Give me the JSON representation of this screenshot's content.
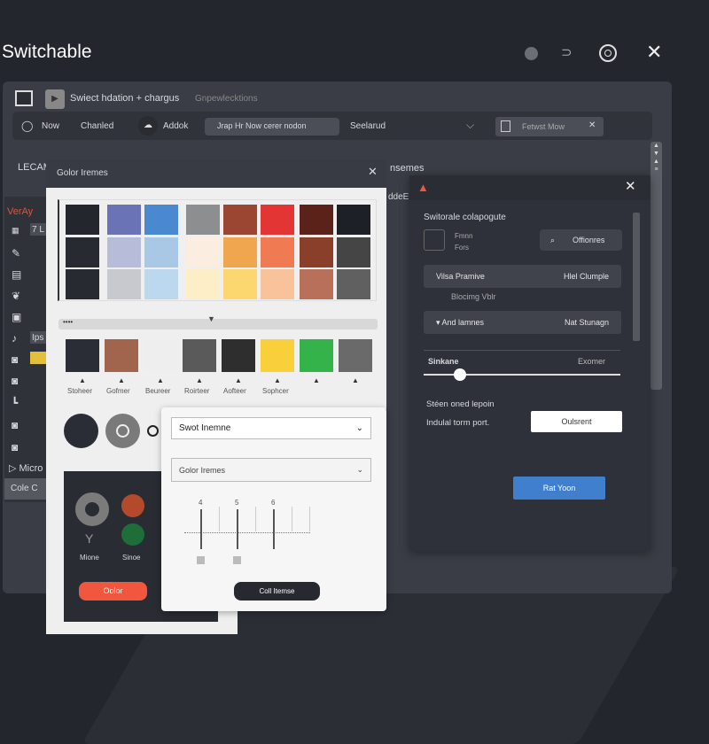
{
  "app": {
    "title": "Switchable"
  },
  "window": {
    "title": "Swiect hdation + chargus",
    "subtitle": "Gnpewlecktions"
  },
  "toolbar": {
    "items": [
      "Now",
      "Chanled",
      "Addok"
    ],
    "search_value": "Jrap  Hr  Now cerer nodon",
    "dropdown": "Seelarud",
    "tab_label": "Fetwst  Mow"
  },
  "second_row": {
    "left": "LECAM",
    "right1": "nsemes",
    "right2": "ddeE"
  },
  "sidebar": {
    "heading": "VerAy",
    "field1": "7 L",
    "field2": "Ips",
    "bottom_item": "Micro",
    "bottom_tab1": "Cole",
    "bottom_tab2": "C"
  },
  "color_dialog": {
    "title": "Golor Iremes",
    "grid": [
      [
        "#24262d",
        "#6a73b6",
        "#4a88cf",
        "#8d8e90",
        "#9a4632",
        "#e23534",
        "#5a2218",
        "#1e2027"
      ],
      [
        "#272a31",
        "#b7bcd8",
        "#a9c8e6",
        "#fbeee0",
        "#f0a54f",
        "#f07a52",
        "#8a3f2a",
        "#454545"
      ],
      [
        "#272a31",
        "#c7c9ce",
        "#bcd8ee",
        "#fcefc8",
        "#fcd770",
        "#f8c29b",
        "#b9705a",
        "#606060"
      ]
    ],
    "swatches": [
      {
        "color": "#2a2d35",
        "label": "Stoheer"
      },
      {
        "color": "#a0654c",
        "label": "Gofmer"
      },
      {
        "color": "#eeeeee",
        "label": "Beureer"
      },
      {
        "color": "#5a5a5a",
        "label": "Roirteer"
      },
      {
        "color": "#2e2e2e",
        "label": "Aofteer"
      },
      {
        "color": "#f9cf3c",
        "label": "Sophcer"
      },
      {
        "color": "#33b34a",
        "label": ""
      },
      {
        "color": "#6a6a6a",
        "label": ""
      }
    ],
    "card": {
      "label1": "Mione",
      "label2": "Sinoe",
      "button": "Oolor"
    }
  },
  "theme_card": {
    "select1": "Swot Inemne",
    "select2": "Golor Iremes",
    "ticks": [
      "4",
      "5",
      "6"
    ],
    "button": "Coll Itemse"
  },
  "right_panel": {
    "title": "Switorale colapogute",
    "check_line1": "Fmnn",
    "check_line2": "Fors",
    "search_button": "Offionres",
    "row1_left": "Vilsa Pramive",
    "row1_right": "Hlel Clumple",
    "sub": "Blocimg  Vblr",
    "row2_left": "And lamnes",
    "row2_right": "Nat Stunagn",
    "slider_label": "Sinkane",
    "slider_right": "Exomer",
    "slider_value": 0.15,
    "text1": "Stéen oned lepoin",
    "text2": "Indulal torm port.",
    "outline_button": "Oulsrent",
    "primary_button": "Rat Yoon"
  },
  "colors": {
    "accent_blue": "#3f7fcb",
    "accent_orange": "#f0573e"
  }
}
